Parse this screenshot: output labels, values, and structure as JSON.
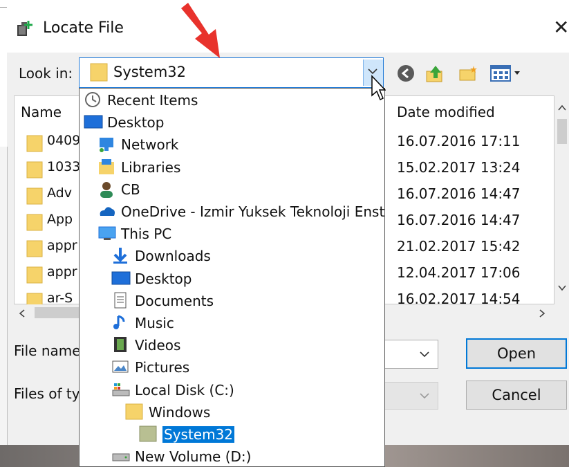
{
  "window": {
    "title": "Locate File",
    "close_glyph": "✕"
  },
  "lookin": {
    "label": "Look in:",
    "value": "System32"
  },
  "toolbar": {
    "icons": [
      "back-icon",
      "up-folder-icon",
      "new-folder-icon",
      "view-menu-icon"
    ]
  },
  "filelist": {
    "columns": {
      "name": "Name",
      "date": "Date modified"
    },
    "rows": [
      {
        "name": "0409",
        "date": "16.07.2016 17:11"
      },
      {
        "name": "1033",
        "date": "15.02.2017 13:24"
      },
      {
        "name": "Adv",
        "date": "16.07.2016 14:47"
      },
      {
        "name": "App",
        "date": "16.07.2016 14:47"
      },
      {
        "name": "appr",
        "date": "21.02.2017 15:42"
      },
      {
        "name": "appr",
        "date": "12.04.2017 17:06"
      },
      {
        "name": "ar-S",
        "date": "16.02.2017 14:54"
      }
    ]
  },
  "footer": {
    "filename_label": "File name",
    "filetype_label": "Files of typ",
    "open_label": "Open",
    "cancel_label": "Cancel"
  },
  "dropdown": {
    "items": [
      {
        "label": "Recent Items",
        "icon": "recent-items-icon"
      },
      {
        "label": "Desktop",
        "icon": "desktop-icon"
      },
      {
        "label": "Network",
        "icon": "network-icon"
      },
      {
        "label": "Libraries",
        "icon": "libraries-icon"
      },
      {
        "label": "CB",
        "icon": "user-icon"
      },
      {
        "label": "OneDrive - Izmir Yuksek Teknoloji Enstit",
        "icon": "onedrive-icon"
      },
      {
        "label": "This PC",
        "icon": "this-pc-icon"
      },
      {
        "label": "Downloads",
        "icon": "downloads-icon"
      },
      {
        "label": "Desktop",
        "icon": "desktop-icon"
      },
      {
        "label": "Documents",
        "icon": "documents-icon"
      },
      {
        "label": "Music",
        "icon": "music-icon"
      },
      {
        "label": "Videos",
        "icon": "videos-icon"
      },
      {
        "label": "Pictures",
        "icon": "pictures-icon"
      },
      {
        "label": "Local Disk (C:)",
        "icon": "local-disk-icon"
      },
      {
        "label": "Windows",
        "icon": "folder-icon"
      },
      {
        "label": "System32",
        "icon": "folder-icon",
        "selected": true
      },
      {
        "label": "New Volume (D:)",
        "icon": "drive-icon"
      }
    ]
  },
  "colors": {
    "accent": "#0078d7",
    "arrow": "#e8322c",
    "folder": "#f6d36a"
  }
}
